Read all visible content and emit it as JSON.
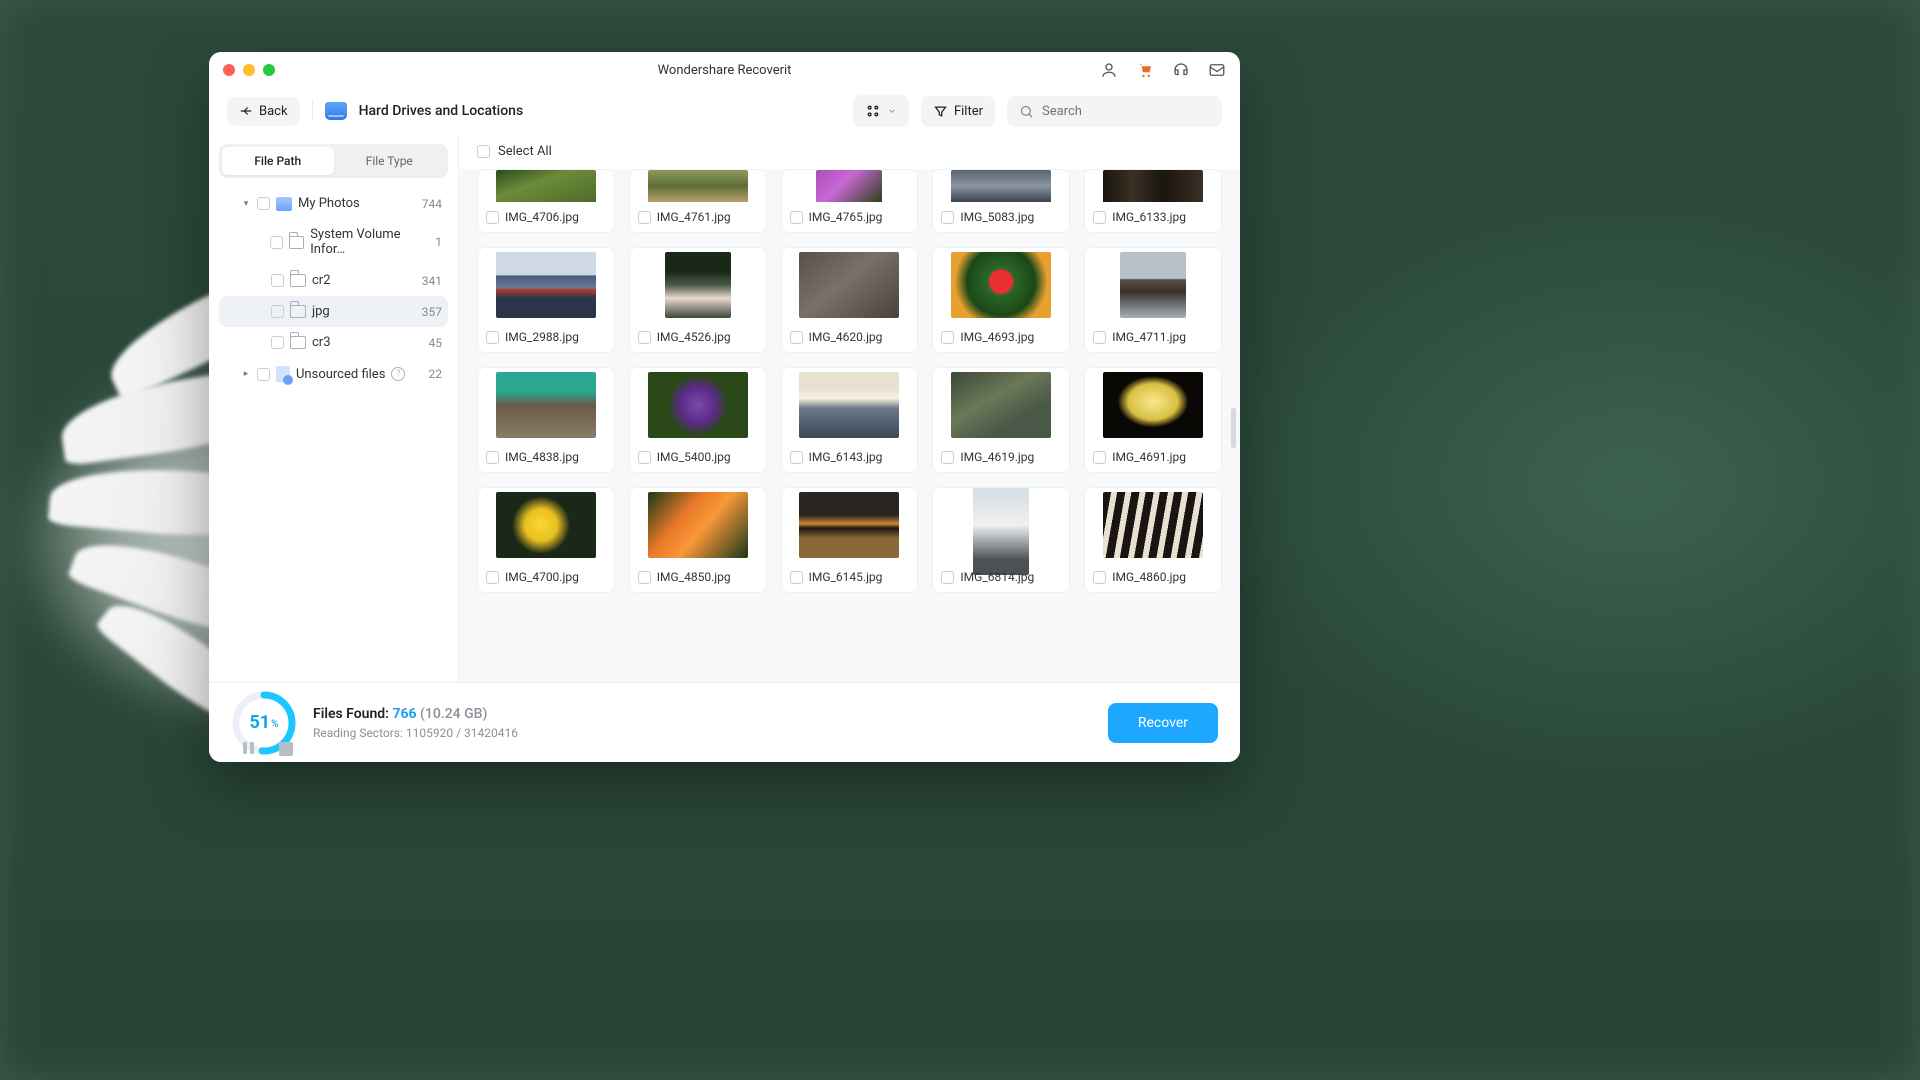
{
  "window": {
    "title": "Wondershare Recoverit"
  },
  "toolbar": {
    "back": "Back",
    "breadcrumb": "Hard Drives and Locations",
    "filter": "Filter",
    "search_placeholder": "Search"
  },
  "sidebar": {
    "tabs": {
      "path": "File Path",
      "type": "File Type"
    },
    "tree": [
      {
        "label": "My Photos",
        "count": "744",
        "icon": "drive",
        "indent": 0,
        "caret": "▾"
      },
      {
        "label": "System Volume Infor…",
        "count": "1",
        "icon": "folder",
        "indent": 1
      },
      {
        "label": "cr2",
        "count": "341",
        "icon": "folder",
        "indent": 1
      },
      {
        "label": "jpg",
        "count": "357",
        "icon": "folder",
        "indent": 1,
        "selected": true
      },
      {
        "label": "cr3",
        "count": "45",
        "icon": "folder",
        "indent": 1
      },
      {
        "label": "Unsourced files",
        "count": "22",
        "icon": "unsourced",
        "indent": 0,
        "caret": "▸",
        "help": true
      }
    ]
  },
  "content": {
    "select_all": "Select All",
    "files": [
      {
        "name": "IMG_4706.jpg",
        "bg": "linear-gradient(160deg,#2d4a1e,#6b8c3a 40%,#4d6b28)",
        "peek": true
      },
      {
        "name": "IMG_4761.jpg",
        "bg": "linear-gradient(#8a9b5a,#5e6d38 50%,#b8a06a)",
        "peek": true
      },
      {
        "name": "IMG_4765.jpg",
        "bg": "linear-gradient(135deg,#a84db5,#c968d6 40%,#2b4018)",
        "peek": true,
        "narrow": true
      },
      {
        "name": "IMG_5083.jpg",
        "bg": "linear-gradient(#5a6570,#8a95a0 50%,#3a4550)",
        "peek": true
      },
      {
        "name": "IMG_6133.jpg",
        "bg": "linear-gradient(90deg,#1a1510,#3a3025 30%,#1a1510 60%,#3a3025)",
        "peek": true
      },
      {
        "name": "IMG_2988.jpg",
        "bg": "linear-gradient(#cfd8e5 35%,#4a5b7a 36%,#6a7b9a 55%,#b84030 56%,#2a3548 70%)"
      },
      {
        "name": "IMG_4526.jpg",
        "bg": "linear-gradient(#1a2818 30%,#4a5a48 50%,#e8d8d0 70%,#3a4838)",
        "narrow": true
      },
      {
        "name": "IMG_4620.jpg",
        "bg": "linear-gradient(140deg,#5a5048,#7a7068 45%,#4a4238)"
      },
      {
        "name": "IMG_4693.jpg",
        "bg": "radial-gradient(circle at 50% 45%,#e83030 0%,#e83030 18%,#2a6828 22%,#1a4818 55%,#e8a030 75%)"
      },
      {
        "name": "IMG_4711.jpg",
        "bg": "linear-gradient(#b8c0c8 40%,#5a5048 42%,#3a3028 60%,#a8b0b8)",
        "narrow": true
      },
      {
        "name": "IMG_4838.jpg",
        "bg": "linear-gradient(#2aa890 30%,#6a5a48 50%,#8a7a68)"
      },
      {
        "name": "IMG_5400.jpg",
        "bg": "radial-gradient(circle at 50% 50%,#7a4aa8 0%,#5a2a88 30%,#2a4818 50%)"
      },
      {
        "name": "IMG_6143.jpg",
        "bg": "linear-gradient(#e8e0d0 25%,#f8f0e0 40%,#6a7888 55%,#3a4858)"
      },
      {
        "name": "IMG_4619.jpg",
        "bg": "linear-gradient(150deg,#3a4838,#6a7858 40%,#4a5848 70%)"
      },
      {
        "name": "IMG_4691.jpg",
        "bg": "radial-gradient(ellipse at 50% 45%,#f8e890 0%,#d8c040 35%,#0a0805 50%)"
      },
      {
        "name": "IMG_4700.jpg",
        "bg": "radial-gradient(circle at 45% 50%,#f8d830 0%,#e8c020 25%,#1a2818 45%)",
        "clipped": true
      },
      {
        "name": "IMG_4850.jpg",
        "bg": "linear-gradient(130deg,#1a3818,#e87828 35%,#f89838 55%,#1a3818)",
        "clipped": true
      },
      {
        "name": "IMG_6145.jpg",
        "bg": "linear-gradient(#2a2520 35%,#c88838 48%,#1a1510 55%,#8a6838 70%)",
        "clipped": true
      },
      {
        "name": "IMG_6814.jpg",
        "bg": "linear-gradient(#d8e0e8 20%,#f0f0f0 50%,#4a5258 85%)",
        "narrow2": true,
        "clipped": true
      },
      {
        "name": "IMG_4860.jpg",
        "bg": "repeating-linear-gradient(100deg,#1a1510 0 8px,#e8e0d0 8px 14px)",
        "clipped": true
      }
    ]
  },
  "footer": {
    "progress_pct": "51",
    "progress_unit": "%",
    "progress_value": 51,
    "files_found_label": "Files Found: ",
    "files_found_count": "766",
    "files_found_size": " (10.24 GB)",
    "status": "Reading Sectors: 1105920 / 31420416",
    "recover": "Recover"
  }
}
